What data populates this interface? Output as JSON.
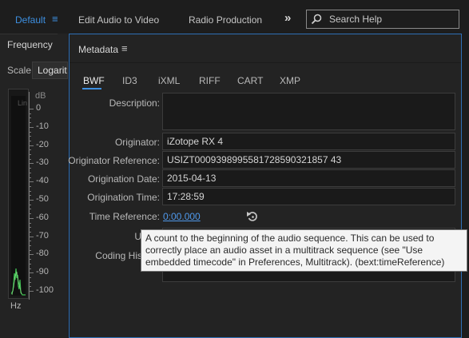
{
  "workspace": {
    "default_label": "Default",
    "tabs": [
      "Edit Audio to Video",
      "Radio Production"
    ],
    "more_symbol": "»",
    "search_placeholder": "Search Help"
  },
  "frequency_panel": {
    "title": "Frequency",
    "scale_label": "Scale:",
    "scale_value": "Logarithmic",
    "unit_top": "dB",
    "unit_bottom": "Hz",
    "lin_label": "Lin",
    "db_ticks": [
      "0",
      "-10",
      "-20",
      "-30",
      "-40",
      "-50",
      "-60",
      "-70",
      "-80",
      "-90",
      "-100"
    ]
  },
  "metadata_panel": {
    "title": "Metadata",
    "tabs": [
      "BWF",
      "ID3",
      "iXML",
      "RIFF",
      "CART",
      "XMP"
    ],
    "active_tab": "BWF",
    "fields": {
      "description": {
        "label": "Description:",
        "value": ""
      },
      "originator": {
        "label": "Originator:",
        "value": "iZotope RX 4"
      },
      "originator_reference": {
        "label": "Originator Reference:",
        "value": "USIZT0009398995581728590321857 43"
      },
      "origination_date": {
        "label": "Origination Date:",
        "value": "2015-04-13"
      },
      "origination_time": {
        "label": "Origination Time:",
        "value": "17:28:59"
      },
      "time_reference": {
        "label": "Time Reference:",
        "value": "0:00.000"
      },
      "umid": {
        "label": "U",
        "value": ""
      },
      "coding_history": {
        "label": "Coding His",
        "value": ""
      }
    },
    "tooltip": "A count to the beginning of the audio sequence. This can be used to correctly place an audio asset in a multitrack sequence (see \"Use embedded timecode\" in Preferences, Multitrack). (bext:timeReference)"
  },
  "colors": {
    "accent": "#3d8fe0",
    "link": "#4f98ea",
    "panel_bg": "#232323",
    "field_bg": "#1a1a1a",
    "tooltip_bg": "#f4f4f4",
    "meter_green": "#3fbf52"
  }
}
